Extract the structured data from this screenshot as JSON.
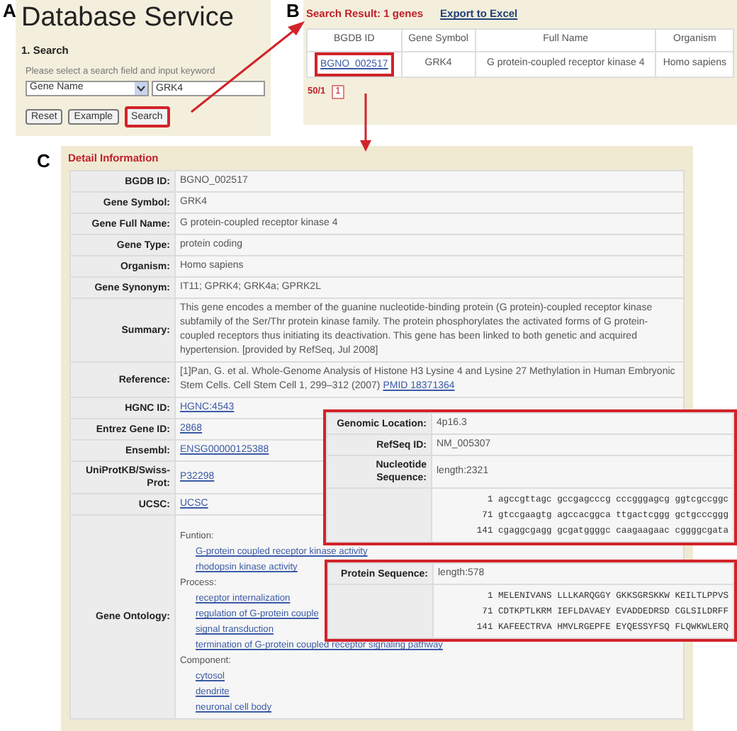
{
  "search_panel": {
    "letter": "A",
    "title": "Database Service",
    "section": "1. Search",
    "prompt": "Please select a search field and input keyword",
    "field": {
      "value": "Gene Name"
    },
    "keyword": {
      "value": "GRK4"
    },
    "buttons": [
      {
        "label": "Reset",
        "highlighted": false
      },
      {
        "label": "Example",
        "highlighted": false
      },
      {
        "label": "Search",
        "highlighted": true
      }
    ]
  },
  "results_panel": {
    "letter": "B",
    "heading": "Search Result: 1 genes",
    "export_link": "Export to Excel",
    "columns": [
      "BGDB ID",
      "Gene Symbol",
      "Full Name",
      "Organism"
    ],
    "rows": [
      {
        "cells": [
          {
            "text": "BGNO_002517",
            "link": true,
            "highlighted": true
          },
          {
            "text": "GRK4",
            "link": false,
            "highlighted": false
          },
          {
            "text": "G protein-coupled receptor kinase 4",
            "link": false,
            "highlighted": false
          },
          {
            "text": "Homo sapiens",
            "link": false,
            "highlighted": false
          }
        ]
      }
    ],
    "pager": {
      "count": "50/1",
      "pages": [
        "1"
      ]
    }
  },
  "detail_panel": {
    "letter": "C",
    "heading": "Detail Information",
    "rows": [
      {
        "label": "BGDB ID:",
        "kind": "text",
        "value": "BGNO_002517"
      },
      {
        "label": "Gene Symbol:",
        "kind": "text",
        "value": "GRK4"
      },
      {
        "label": "Gene Full Name:",
        "kind": "text",
        "value": "G protein-coupled receptor kinase 4"
      },
      {
        "label": "Gene Type:",
        "kind": "text",
        "value": "protein coding"
      },
      {
        "label": "Organism:",
        "kind": "text",
        "value": "Homo sapiens"
      },
      {
        "label": "Gene Synonym:",
        "kind": "text",
        "value": "IT11; GPRK4; GRK4a; GPRK2L"
      },
      {
        "label": "Summary:",
        "kind": "text",
        "value": "This gene encodes a member of the guanine nucleotide-binding protein (G protein)-coupled receptor kinase subfamily of the Ser/Thr protein kinase family. The protein phosphorylates the activated forms of G protein-coupled receptors thus initiating its deactivation. This gene has been linked to both genetic and acquired hypertension. [provided by RefSeq, Jul 2008]"
      },
      {
        "label": "Reference:",
        "kind": "reference",
        "value": "[1]Pan, G. et al. Whole-Genome Analysis of Histone H3 Lysine 4 and Lysine 27 Methylation in Human Embryonic Stem Cells. Cell Stem Cell 1, 299–312 (2007)",
        "link": "PMID 18371364"
      },
      {
        "label": "HGNC ID:",
        "kind": "link",
        "value": "HGNC:4543"
      },
      {
        "label": "Entrez Gene ID:",
        "kind": "link",
        "value": "2868"
      },
      {
        "label": "Ensembl:",
        "kind": "link",
        "value": "ENSG00000125388"
      },
      {
        "label": "UniProtKB/Swiss-Prot:",
        "kind": "link",
        "value": "P32298"
      },
      {
        "label": "UCSC:",
        "kind": "link",
        "value": "UCSC"
      },
      {
        "label": "Gene Ontology:",
        "kind": "ontology",
        "groups": [
          {
            "heading": "Funtion:",
            "terms": [
              "G-protein coupled receptor kinase activity",
              "rhodopsin kinase activity"
            ]
          },
          {
            "heading": "Process:",
            "terms": [
              "receptor internalization",
              "regulation of G-protein couple",
              "signal transduction",
              "termination of G-protein coupled receptor signaling pathway"
            ]
          },
          {
            "heading": "Component:",
            "terms": [
              "cytosol",
              "dendrite",
              "neuronal cell body"
            ]
          }
        ]
      }
    ]
  },
  "insets": [
    {
      "rows": [
        {
          "label": "Genomic Location:",
          "kind": "text",
          "value": "4p16.3"
        },
        {
          "label": "RefSeq ID:",
          "kind": "text",
          "value": "NM_005307"
        },
        {
          "label": "Nucleotide Sequence:",
          "kind": "text",
          "value": "length:2321"
        },
        {
          "kind": "sequence",
          "lines": [
            "1 agccgttagc gccgagcccg cccgggagcg ggtcgccggc",
            "71 gtccgaagtg agccacggca ttgactcggg gctgcccggg",
            "141 cgaggcgagg gcgatggggc caagaagaac cggggcgata"
          ]
        }
      ]
    },
    {
      "rows": [
        {
          "label": "Protein Sequence:",
          "kind": "text",
          "value": "length:578"
        },
        {
          "kind": "sequence",
          "lines": [
            "1 MELENIVANS LLLKARQGGY GKKSGRSKKW KEILTLPPVS",
            "71 CDTKPTLKRM IEFLDAVAEY EVADDEDRSD CGLSILDRFF",
            "141 KAFEECTRVA HMVLRGEPFE EYQESSYFSQ FLQWKWLERQ"
          ]
        }
      ]
    }
  ]
}
